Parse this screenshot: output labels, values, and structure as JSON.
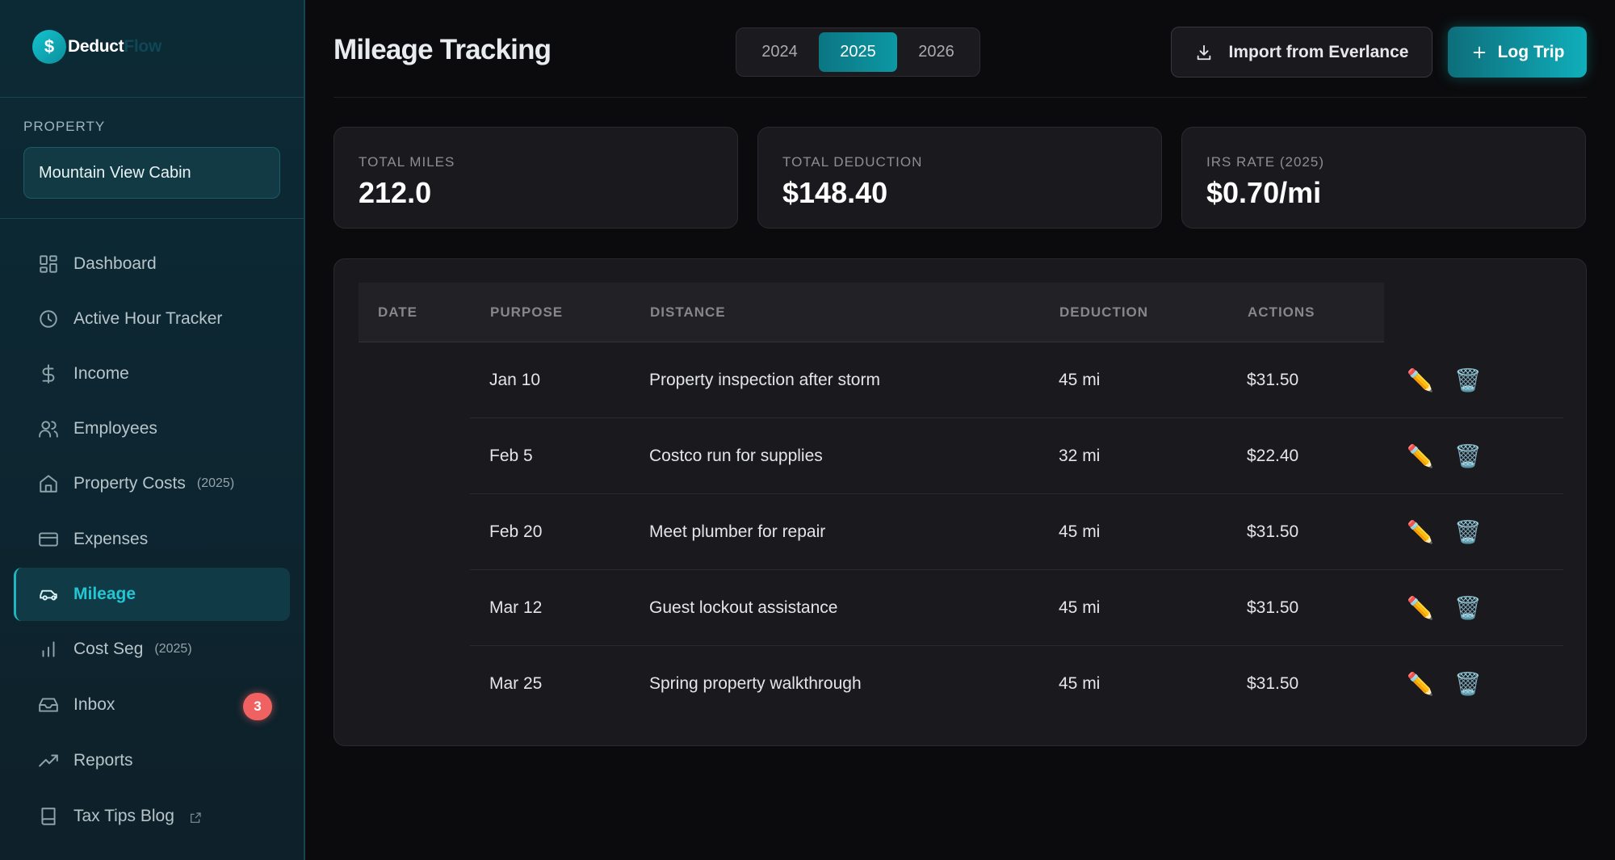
{
  "brand": {
    "logo_glyph": "$",
    "name_a": "Deduct",
    "name_b": "Flow"
  },
  "sidebar": {
    "property_label": "PROPERTY",
    "property_value": "Mountain View Cabin",
    "items": [
      {
        "label": "Dashboard",
        "icon": "grid-icon"
      },
      {
        "label": "Active Hour Tracker",
        "icon": "clock-icon"
      },
      {
        "label": "Income",
        "icon": "dollar-icon"
      },
      {
        "label": "Employees",
        "icon": "users-icon"
      },
      {
        "label": "Property Costs",
        "icon": "home-icon",
        "year": "(2025)"
      },
      {
        "label": "Expenses",
        "icon": "credit-card-icon"
      },
      {
        "label": "Mileage",
        "icon": "car-icon",
        "active": true
      },
      {
        "label": "Cost Seg",
        "icon": "bar-chart-icon",
        "year": "(2025)"
      },
      {
        "label": "Inbox",
        "icon": "inbox-icon",
        "badge": "3"
      },
      {
        "label": "Reports",
        "icon": "trending-up-icon"
      },
      {
        "label": "Tax Tips Blog",
        "icon": "book-icon",
        "external": true
      }
    ]
  },
  "header": {
    "title": "Mileage Tracking",
    "years": [
      "2024",
      "2025",
      "2026"
    ],
    "active_year": "2025",
    "import_label": "Import from Everlance",
    "log_label": "Log Trip"
  },
  "stats": [
    {
      "label": "TOTAL MILES",
      "value": "212.0"
    },
    {
      "label": "TOTAL DEDUCTION",
      "value": "$148.40"
    },
    {
      "label": "IRS RATE (2025)",
      "value": "$0.70/mi"
    }
  ],
  "table": {
    "columns": [
      "DATE",
      "PURPOSE",
      "DISTANCE",
      "DEDUCTION",
      "ACTIONS"
    ],
    "rows": [
      {
        "date": "Jan 10",
        "purpose": "Property inspection after storm",
        "distance": "45 mi",
        "deduction": "$31.50"
      },
      {
        "date": "Feb 5",
        "purpose": "Costco run for supplies",
        "distance": "32 mi",
        "deduction": "$22.40"
      },
      {
        "date": "Feb 20",
        "purpose": "Meet plumber for repair",
        "distance": "45 mi",
        "deduction": "$31.50"
      },
      {
        "date": "Mar 12",
        "purpose": "Guest lockout assistance",
        "distance": "45 mi",
        "deduction": "$31.50"
      },
      {
        "date": "Mar 25",
        "purpose": "Spring property walkthrough",
        "distance": "45 mi",
        "deduction": "$31.50"
      }
    ],
    "edit_glyph": "✏️",
    "delete_glyph": "🗑️"
  },
  "colors": {
    "accent": "#22c7d3",
    "badge": "#f06262",
    "background": "#0b0b0d"
  }
}
